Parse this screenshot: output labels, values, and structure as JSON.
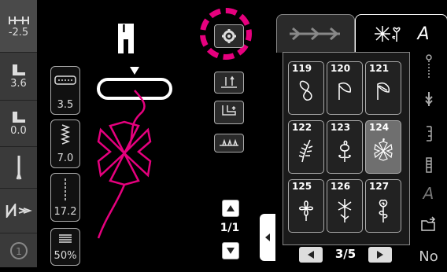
{
  "left_panel": {
    "needle_position_value": "-2.5",
    "foot_pressure_value": "3.6",
    "stitch_offset_value": "0.0"
  },
  "settings": {
    "width_value": "3.5",
    "length_value": "7.0",
    "density_value": "17.2",
    "percent_value": "50%"
  },
  "needle_indicator": "I",
  "stitch_pager": {
    "page": "1/1"
  },
  "tabs": {
    "tab2_label": "A"
  },
  "patterns": [
    {
      "num": "119",
      "icon": "figure-eight-icon"
    },
    {
      "num": "120",
      "icon": "leaf-outline-icon"
    },
    {
      "num": "121",
      "icon": "leaf-filled-icon"
    },
    {
      "num": "122",
      "icon": "fern-icon"
    },
    {
      "num": "123",
      "icon": "swirl-flower-icon"
    },
    {
      "num": "124",
      "icon": "star-flower-icon"
    },
    {
      "num": "125",
      "icon": "clover-icon"
    },
    {
      "num": "126",
      "icon": "daisy-icon"
    },
    {
      "num": "127",
      "icon": "rose-icon"
    }
  ],
  "selected_pattern": "124",
  "page_indicator": "3/5",
  "right_bottom_label": "No",
  "right_italic_label": "A",
  "colors": {
    "highlight": "#e6007e",
    "selected": "#6f6f6f"
  }
}
